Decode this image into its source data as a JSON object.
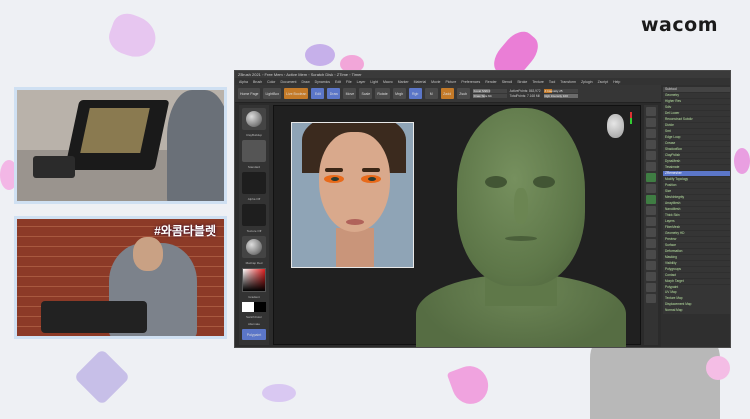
{
  "brand": {
    "name": "wacom"
  },
  "camera2": {
    "label": "#와콤타블렛"
  },
  "app": {
    "titlebar": "ZBrush 2021 ◦ Free Mem ◦ Active Mem ◦ Scratch Disk ◦ ZTime ◦ Timer",
    "menu": [
      "Alpha",
      "Brush",
      "Color",
      "Document",
      "Draw",
      "Dynamics",
      "Edit",
      "File",
      "Layer",
      "Light",
      "Macro",
      "Marker",
      "Material",
      "Movie",
      "Picture",
      "Preferences",
      "Render",
      "Stencil",
      "Stroke",
      "Texture",
      "Tool",
      "Transform",
      "Zplugin",
      "Zscript",
      "Help"
    ],
    "toolstrip": {
      "buttons": [
        "Home Page",
        "LightBox",
        "Live Boolean",
        "Edit",
        "Draw",
        "Move",
        "Scale",
        "Rotate"
      ],
      "mrgb": "Mrgb",
      "rgb": "Rgb",
      "m": "M",
      "zadd": "Zadd",
      "zsub": "Zsub",
      "focal_shift": "Focal Shift 0",
      "draw_size": "Draw Size 64",
      "active_points": "ActivePoints: 863,972",
      "total_points": "TotalPoints: 7.168 Mil",
      "z_intensity": "Z Intensity 25",
      "rgb_intensity": "Rgb Intensity 100"
    },
    "left_tools": {
      "labels": [
        "ClayBuildup",
        "Standard",
        "Alpha Off",
        "Texture Off",
        "MatCap Red",
        "Gradient",
        "SwitchColor",
        "Alternate",
        "Polypaint"
      ],
      "brush_name": "ClayBuildup"
    },
    "right_panel": {
      "header1": "Subtool",
      "items": [
        "Geometry",
        "Higher Res",
        "Sdiv",
        "Del Lower",
        "Reconstruct Subdiv",
        "Divide",
        "Smt",
        "Edge Loop",
        "Crease",
        "ShadowBox",
        "ClayPolish",
        "DynaMesh",
        "Tessimate",
        "ZRemesher",
        "Modify Topology",
        "Position",
        "Size",
        "MeshIntegrity",
        "ArrayMesh",
        "NanoMesh",
        "Thick Skin",
        "Layers",
        "FiberMesh",
        "Geometry HD",
        "Preview",
        "Surface",
        "Deformation",
        "Masking",
        "Visibility",
        "Polygroups",
        "Contact",
        "Morph Target",
        "Polypaint",
        "UV Map",
        "Texture Map",
        "Displacement Map",
        "Normal Map"
      ],
      "selected": "ZRemesher"
    }
  },
  "colors": {
    "accent_blue": "#5b76c8",
    "model_green": "#5d7648",
    "frame": "#cfe0f2"
  }
}
